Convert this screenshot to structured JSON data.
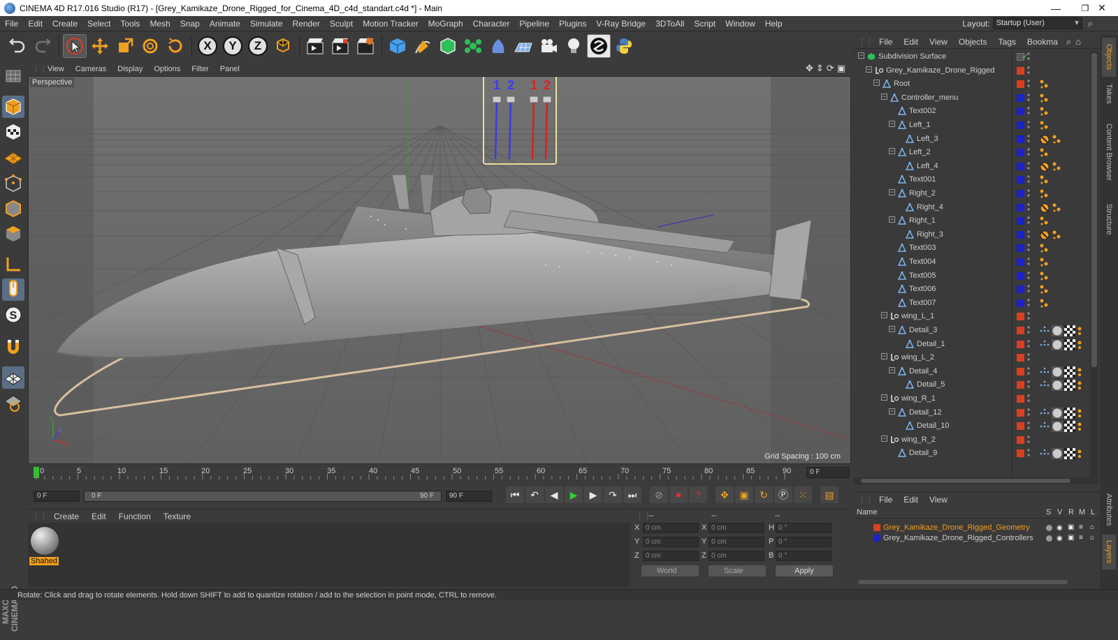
{
  "window": {
    "title": "CINEMA 4D R17.016 Studio (R17) - [Grey_Kamikaze_Drone_Rigged_for_Cinema_4D_c4d_standart.c4d *] - Main",
    "minimize": "—",
    "maximize": "❐",
    "close": "✕"
  },
  "menubar": {
    "items": [
      "File",
      "Edit",
      "Create",
      "Select",
      "Tools",
      "Mesh",
      "Snap",
      "Animate",
      "Simulate",
      "Render",
      "Sculpt",
      "Motion Tracker",
      "MoGraph",
      "Character",
      "Pipeline",
      "Plugins",
      "V-Ray Bridge",
      "3DToAll",
      "Script",
      "Window",
      "Help"
    ],
    "layout_label": "Layout:",
    "layout_value": "Startup (User)"
  },
  "toolbar": {
    "axis_x": "X",
    "axis_y": "Y",
    "axis_z": "Z"
  },
  "viewport": {
    "menu": [
      "View",
      "Cameras",
      "Display",
      "Options",
      "Filter",
      "Panel"
    ],
    "camera_label": "Perspective",
    "grid_spacing": "Grid Spacing : 100 cm",
    "controller_labels": [
      "1",
      "2",
      "1",
      "2"
    ]
  },
  "timeline": {
    "ticks": [
      "0",
      "5",
      "10",
      "15",
      "20",
      "25",
      "30",
      "35",
      "40",
      "45",
      "50",
      "55",
      "60",
      "65",
      "70",
      "75",
      "80",
      "85",
      "90"
    ],
    "current_frame": "0 F"
  },
  "transport": {
    "start_field": "0 F",
    "range_start": "0 F",
    "range_end": "90 F",
    "end_field": "90 F"
  },
  "material_manager": {
    "menu": [
      "Create",
      "Edit",
      "Function",
      "Texture"
    ],
    "material_name": "Shahed"
  },
  "coordinates": {
    "header": [
      "--",
      "--",
      "--"
    ],
    "rows": [
      {
        "pos_label": "X",
        "pos": "0 cm",
        "size_label": "X",
        "size": "0 cm",
        "rot_label": "H",
        "rot": "0 °"
      },
      {
        "pos_label": "Y",
        "pos": "0 cm",
        "size_label": "Y",
        "size": "0 cm",
        "rot_label": "P",
        "rot": "0 °"
      },
      {
        "pos_label": "Z",
        "pos": "0 cm",
        "size_label": "Z",
        "size": "0 cm",
        "rot_label": "B",
        "rot": "0 °"
      }
    ],
    "mode": "World",
    "size_mode": "Scale",
    "apply": "Apply"
  },
  "object_manager": {
    "menu": [
      "File",
      "Edit",
      "View",
      "Objects",
      "Tags",
      "Bookma"
    ],
    "rows": [
      {
        "name": "Subdivision Surface",
        "level": 0,
        "icon": "subdivision-icon",
        "color": "",
        "tags": "check"
      },
      {
        "name": "Grey_Kamikaze_Drone_Rigged",
        "level": 1,
        "icon": "null-icon",
        "color": "#d9401f",
        "tags": ""
      },
      {
        "name": "Root",
        "level": 2,
        "icon": "joint-icon",
        "color": "#d9401f",
        "tags": "dots"
      },
      {
        "name": "Controller_menu",
        "level": 3,
        "icon": "joint-icon",
        "color": "#1a22c9",
        "tags": "dots"
      },
      {
        "name": "Text002",
        "level": 4,
        "icon": "joint-icon",
        "color": "#1a22c9",
        "tags": "dots"
      },
      {
        "name": "Left_1",
        "level": 4,
        "icon": "joint-icon",
        "color": "#1a22c9",
        "tags": "dots"
      },
      {
        "name": "Left_3",
        "level": 5,
        "icon": "joint-icon",
        "color": "#1a22c9",
        "tags": "ban"
      },
      {
        "name": "Left_2",
        "level": 4,
        "icon": "joint-icon",
        "color": "#1a22c9",
        "tags": "dots"
      },
      {
        "name": "Left_4",
        "level": 5,
        "icon": "joint-icon",
        "color": "#1a22c9",
        "tags": "ban"
      },
      {
        "name": "Text001",
        "level": 4,
        "icon": "joint-icon",
        "color": "#1a22c9",
        "tags": "dots"
      },
      {
        "name": "Right_2",
        "level": 4,
        "icon": "joint-icon",
        "color": "#1a22c9",
        "tags": "dots"
      },
      {
        "name": "Right_4",
        "level": 5,
        "icon": "joint-icon",
        "color": "#1a22c9",
        "tags": "ban"
      },
      {
        "name": "Right_1",
        "level": 4,
        "icon": "joint-icon",
        "color": "#1a22c9",
        "tags": "dots"
      },
      {
        "name": "Right_3",
        "level": 5,
        "icon": "joint-icon",
        "color": "#1a22c9",
        "tags": "ban"
      },
      {
        "name": "Text003",
        "level": 4,
        "icon": "joint-icon",
        "color": "#1a22c9",
        "tags": "dots"
      },
      {
        "name": "Text004",
        "level": 4,
        "icon": "joint-icon",
        "color": "#1a22c9",
        "tags": "dots"
      },
      {
        "name": "Text005",
        "level": 4,
        "icon": "joint-icon",
        "color": "#1a22c9",
        "tags": "dots"
      },
      {
        "name": "Text006",
        "level": 4,
        "icon": "joint-icon",
        "color": "#1a22c9",
        "tags": "dots"
      },
      {
        "name": "Text007",
        "level": 4,
        "icon": "joint-icon",
        "color": "#1a22c9",
        "tags": "dots"
      },
      {
        "name": "wing_L_1",
        "level": 3,
        "icon": "null-icon",
        "color": "#d9401f",
        "tags": ""
      },
      {
        "name": "Detail_3",
        "level": 4,
        "icon": "joint-icon",
        "color": "#d9401f",
        "tags": "mat"
      },
      {
        "name": "Detail_1",
        "level": 5,
        "icon": "joint-icon",
        "color": "#d9401f",
        "tags": "mat"
      },
      {
        "name": "wing_L_2",
        "level": 3,
        "icon": "null-icon",
        "color": "#d9401f",
        "tags": ""
      },
      {
        "name": "Detail_4",
        "level": 4,
        "icon": "joint-icon",
        "color": "#d9401f",
        "tags": "mat"
      },
      {
        "name": "Detail_5",
        "level": 5,
        "icon": "joint-icon",
        "color": "#d9401f",
        "tags": "mat"
      },
      {
        "name": "wing_R_1",
        "level": 3,
        "icon": "null-icon",
        "color": "#d9401f",
        "tags": ""
      },
      {
        "name": "Detail_12",
        "level": 4,
        "icon": "joint-icon",
        "color": "#d9401f",
        "tags": "mat"
      },
      {
        "name": "Detail_10",
        "level": 5,
        "icon": "joint-icon",
        "color": "#d9401f",
        "tags": "mat"
      },
      {
        "name": "wing_R_2",
        "level": 3,
        "icon": "null-icon",
        "color": "#d9401f",
        "tags": ""
      },
      {
        "name": "Detail_9",
        "level": 4,
        "icon": "joint-icon",
        "color": "#d9401f",
        "tags": "mat"
      }
    ]
  },
  "right_tabs": [
    "Objects",
    "Takes",
    "Content Browser",
    "Structure",
    "Attributes",
    "Layers"
  ],
  "layer_manager": {
    "menu": [
      "File",
      "Edit",
      "View"
    ],
    "col_name": "Name",
    "cols": [
      "S",
      "V",
      "R",
      "M",
      "L"
    ],
    "rows": [
      {
        "name": "Grey_Kamikaze_Drone_Rigged_Geometry",
        "color": "#d9401f",
        "text_color": "#f0a020"
      },
      {
        "name": "Grey_Kamikaze_Drone_Rigged_Controllers",
        "color": "#1a22c9",
        "text_color": "#cfcfcf"
      }
    ]
  },
  "statusbar": {
    "text": "Rotate: Click and drag to rotate elements. Hold down SHIFT to add to quantize rotation / add to the selection in point mode, CTRL to remove."
  },
  "colors": {
    "accent": "#f0a020",
    "viewport_bg": "#6b6b6b",
    "panel_bg": "#3b3b3b"
  }
}
